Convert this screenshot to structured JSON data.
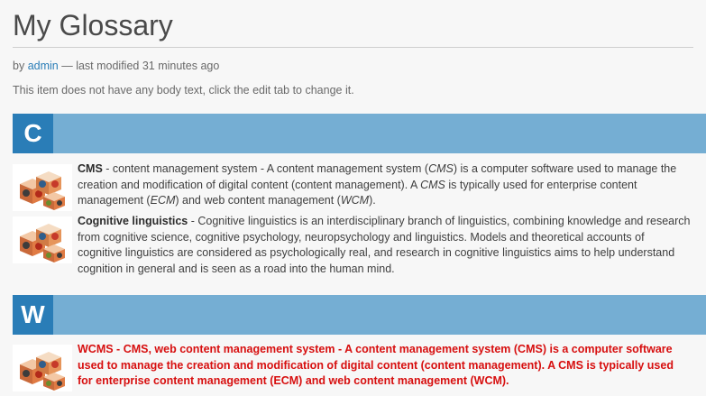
{
  "page": {
    "title": "My Glossary",
    "byline": {
      "prefix": "by",
      "author": "admin",
      "suffix": "— last modified 31 minutes ago"
    },
    "note": "This item does not have any body text, click the edit tab to change it."
  },
  "sections": [
    {
      "letter": "C",
      "entries": [
        {
          "term": "CMS",
          "separator": " - ",
          "definition_parts": [
            {
              "text": "content management system - A content management system (",
              "italic": false
            },
            {
              "text": "CMS",
              "italic": true
            },
            {
              "text": ") is a computer software used to manage the creation and modification of digital content (content management). A ",
              "italic": false
            },
            {
              "text": "CMS",
              "italic": true
            },
            {
              "text": " is typically used for enterprise content management (",
              "italic": false
            },
            {
              "text": "ECM",
              "italic": true
            },
            {
              "text": ") and web content management (",
              "italic": false
            },
            {
              "text": "WCM",
              "italic": true
            },
            {
              "text": ").",
              "italic": false
            }
          ],
          "highlighted": false
        },
        {
          "term": "Cognitive linguistics",
          "separator": " - ",
          "definition_parts": [
            {
              "text": "Cognitive linguistics is an interdisciplinary branch of linguistics, combining knowledge and research from cognitive science, cognitive psychology, neuropsychology and linguistics. Models and theoretical accounts of cognitive linguistics are considered as psychologically real, and research in cognitive linguistics aims to help understand cognition in general and is seen as a road into the human mind.",
              "italic": false
            }
          ],
          "highlighted": false
        }
      ]
    },
    {
      "letter": "W",
      "entries": [
        {
          "term": "WCMS",
          "separator": " - ",
          "definition_parts": [
            {
              "text": "CMS, web content management system - A content management system (CMS) is a computer software used to manage the creation and modification of digital content (content management). A CMS is typically used for enterprise content management (ECM) and web content management (WCM).",
              "italic": false
            }
          ],
          "highlighted": true
        }
      ]
    }
  ],
  "colors": {
    "letter_box": "#2a7db7",
    "header_bar": "#75aed3",
    "link": "#2a7db7",
    "highlight_text": "#d70f0f"
  },
  "icons": {
    "entry_thumbnail": "blocks-cubes-icon"
  }
}
